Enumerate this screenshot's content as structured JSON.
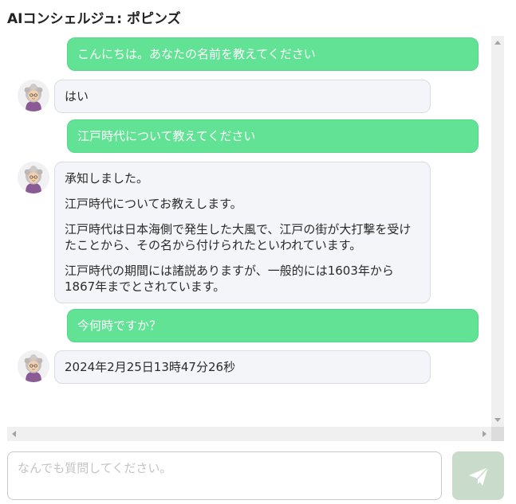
{
  "app": {
    "title": "AIコンシェルジュ: ポピンズ"
  },
  "messages": [
    {
      "role": "user",
      "text": "こんにちは。あなたの名前を教えてください"
    },
    {
      "role": "assistant",
      "paragraphs": [
        "はい"
      ]
    },
    {
      "role": "user",
      "text": "江戸時代について教えてください"
    },
    {
      "role": "assistant",
      "paragraphs": [
        "承知しました。",
        "江戸時代についてお教えします。",
        "江戸時代は日本海側で発生した大風で、江戸の街が大打撃を受けたことから、その名から付けられたといわれています。",
        "江戸時代の期間には諸説ありますが、一般的には1603年から1867年までとされています。"
      ]
    },
    {
      "role": "user",
      "text": "今何時ですか？"
    },
    {
      "role": "assistant",
      "paragraphs": [
        "2024年2月25日13時47分26秒"
      ]
    }
  ],
  "input": {
    "placeholder": "なんでも質問してください。",
    "value": ""
  },
  "send_button": {
    "icon": "paper-plane-icon"
  },
  "colors": {
    "user_bubble": "#61e294",
    "bot_bubble": "#f4f5f8",
    "send_button": "#c9dccb"
  }
}
